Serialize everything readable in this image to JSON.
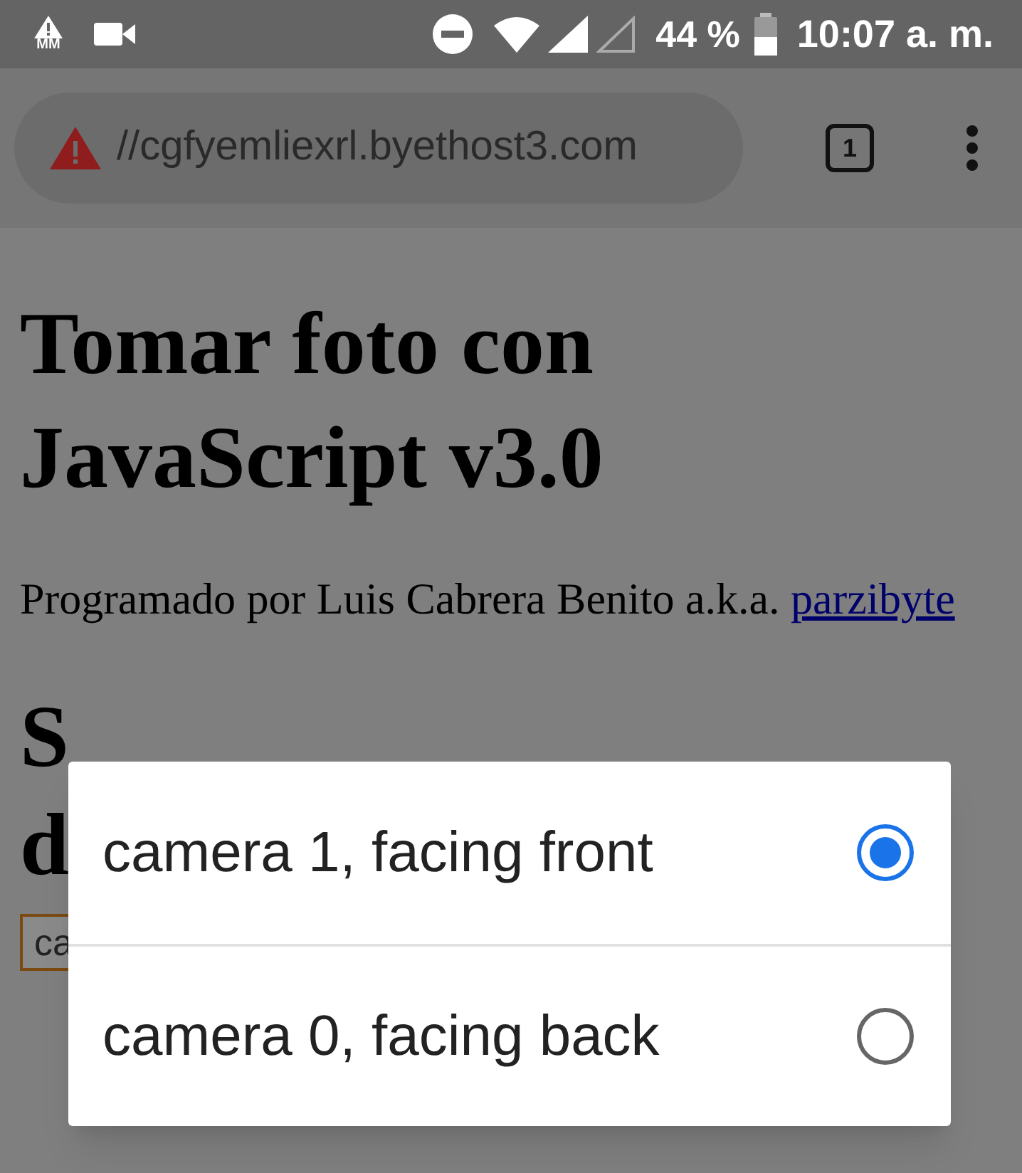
{
  "status_bar": {
    "notification_label": "MM",
    "battery": "44 %",
    "time": "10:07 a. m."
  },
  "url_bar": {
    "url": "//cgfyemliexrl.byethost3.com",
    "tab_count": "1"
  },
  "page": {
    "title": "Tomar foto con JavaScript v3.0",
    "byline": "Programado por Luis Cabrera Benito a.k.a.",
    "link": "parzibyte",
    "heading_fragments": [
      "S",
      "d"
    ],
    "select_value": "ca"
  },
  "dialog": {
    "options": [
      {
        "label": "camera 1, facing front",
        "selected": true
      },
      {
        "label": "camera 0, facing back",
        "selected": false
      }
    ]
  }
}
